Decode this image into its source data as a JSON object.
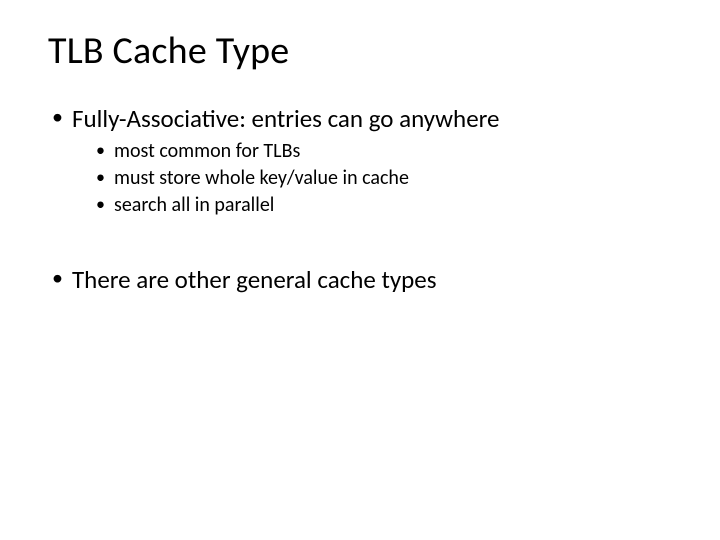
{
  "title": "TLB Cache Type",
  "bullets": [
    {
      "text": "Fully-Associative: entries can go anywhere",
      "sub": [
        "most common for TLBs",
        "must store whole key/value in cache",
        "search all in parallel"
      ]
    },
    {
      "text": "There are other general cache types",
      "sub": []
    }
  ]
}
